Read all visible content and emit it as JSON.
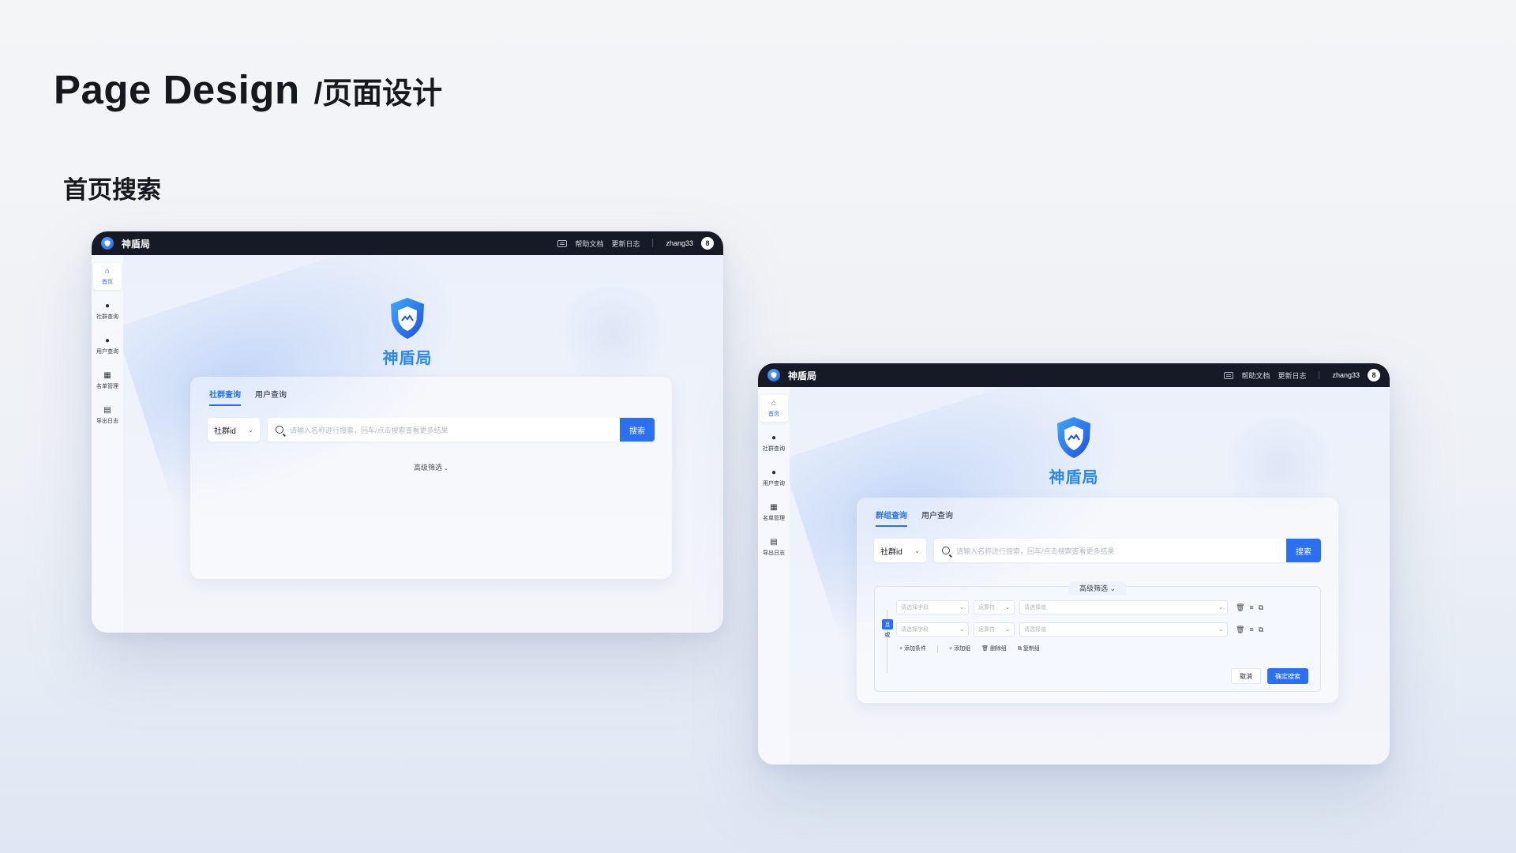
{
  "header": {
    "title_en": "Page Design",
    "title_zh": "/页面设计"
  },
  "section": {
    "title": "首页搜索"
  },
  "app": {
    "brand": "神盾局",
    "topbar": {
      "help_doc": "帮助文档",
      "update_log": "更新日志",
      "user": "zhang33",
      "avatar": "8"
    },
    "sidebar": [
      {
        "label": "首页",
        "icon": "home-icon"
      },
      {
        "label": "社群查询",
        "icon": "person-icon"
      },
      {
        "label": "用户查询",
        "icon": "users-icon"
      },
      {
        "label": "名单管理",
        "icon": "list-edit-icon"
      },
      {
        "label": "导出日志",
        "icon": "export-log-icon"
      }
    ],
    "search": {
      "select_value": "社群id",
      "placeholder": "请输入名称进行搜索，回车/点击搜索查看更多结果",
      "button": "搜索",
      "advanced": "高级筛选"
    }
  },
  "screen1": {
    "tabs": [
      {
        "label": "社群查询",
        "active": true
      },
      {
        "label": "用户查询",
        "active": false
      }
    ]
  },
  "screen2": {
    "tabs": [
      {
        "label": "群组查询",
        "active": true
      },
      {
        "label": "用户查询",
        "active": false
      }
    ],
    "filter": {
      "and_label": "且",
      "or_label": "或",
      "field_placeholder": "请选择字段",
      "operator_placeholder": "运算符",
      "value_placeholder": "请选择值",
      "add_condition": "+ 添加条件",
      "add_group": "+ 添加组",
      "delete_group": "删除组",
      "copy_group": "复制组",
      "cancel": "取消",
      "confirm": "确定搜索"
    }
  },
  "colors": {
    "accent": "#2b6ff2",
    "brand_text": "#2b8ae8",
    "topbar": "#151a26"
  }
}
